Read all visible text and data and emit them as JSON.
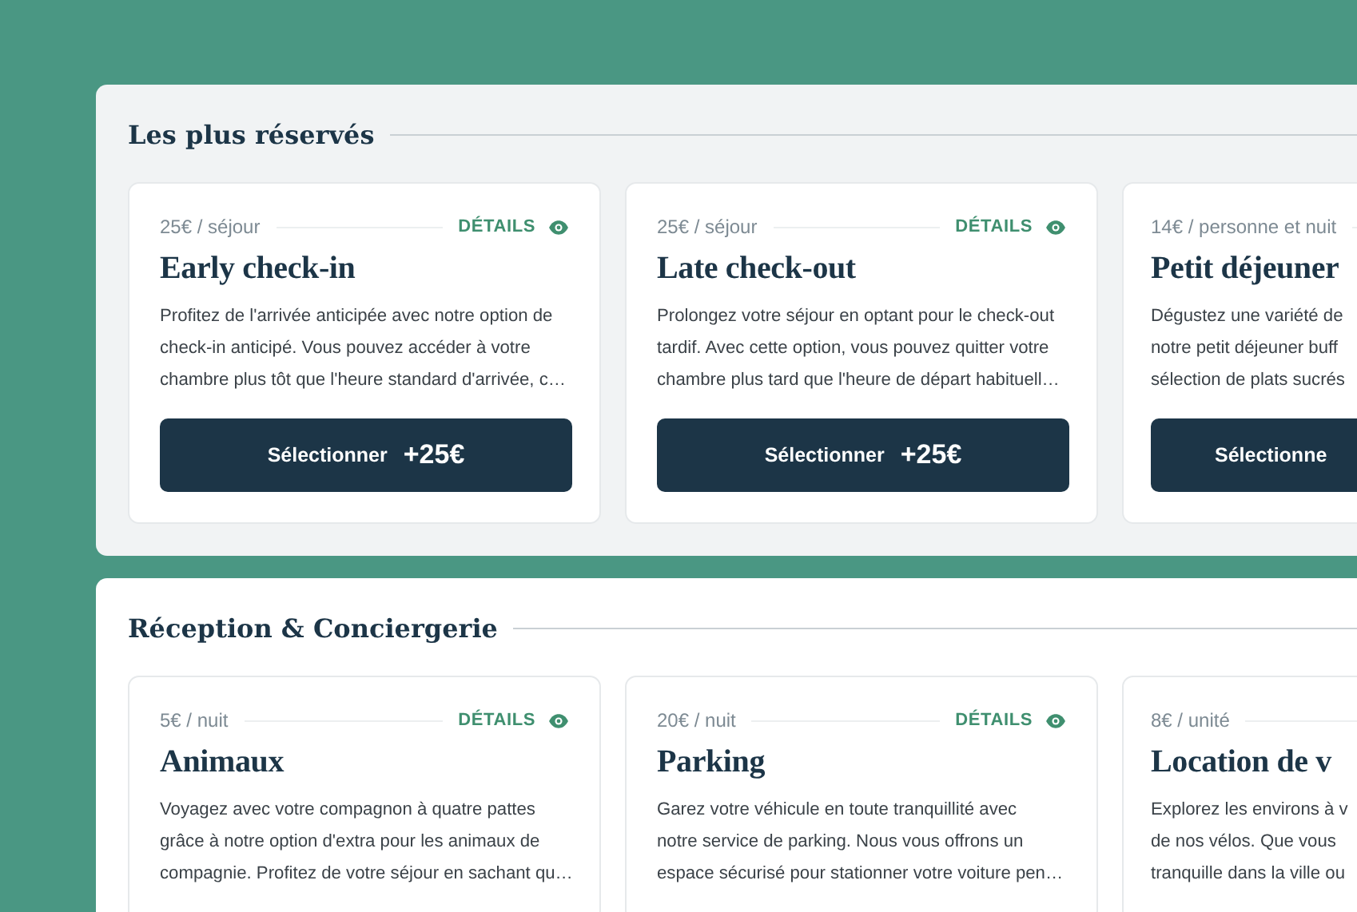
{
  "sections": [
    {
      "title": "Les plus réservés",
      "cards": [
        {
          "price": "25€ / séjour",
          "details": "DÉTAILS",
          "title": "Early check-in",
          "lines": [
            "Profitez de l'arrivée anticipée avec notre option de",
            "check-in anticipé. Vous pouvez accéder à votre",
            "chambre plus tôt que l'heure standard d'arrivée, c…"
          ],
          "button": "Sélectionner",
          "amount": "+25€"
        },
        {
          "price": "25€ / séjour",
          "details": "DÉTAILS",
          "title": "Late check-out",
          "lines": [
            "Prolongez votre séjour en optant pour le check-out",
            "tardif. Avec cette option, vous pouvez quitter votre",
            "chambre plus tard que l'heure de départ habituell…"
          ],
          "button": "Sélectionner",
          "amount": "+25€"
        },
        {
          "kind": "clipped",
          "price": "14€ / personne et nuit",
          "title": "Petit déjeuner",
          "lines": [
            "Dégustez une variété de",
            "notre petit déjeuner buff",
            "sélection de plats sucrés"
          ],
          "button": "Sélectionne"
        }
      ]
    },
    {
      "title": "Réception & Conciergerie",
      "cards": [
        {
          "price": "5€ / nuit",
          "details": "DÉTAILS",
          "title": "Animaux",
          "lines": [
            "Voyagez avec votre compagnon à quatre pattes",
            "grâce à notre option d'extra pour les animaux de",
            "compagnie. Profitez de votre séjour en sachant qu…"
          ]
        },
        {
          "price": "20€ / nuit",
          "details": "DÉTAILS",
          "title": "Parking",
          "lines": [
            "Garez votre véhicule en toute tranquillité avec",
            "notre service de parking. Nous vous offrons un",
            "espace sécurisé pour stationner votre voiture pen…"
          ]
        },
        {
          "kind": "clipped",
          "price": "8€ / unité",
          "title": "Location de v",
          "lines": [
            "Explorez les environs à v",
            "de nos vélos. Que vous",
            "tranquille dans la ville ou"
          ]
        }
      ]
    }
  ]
}
